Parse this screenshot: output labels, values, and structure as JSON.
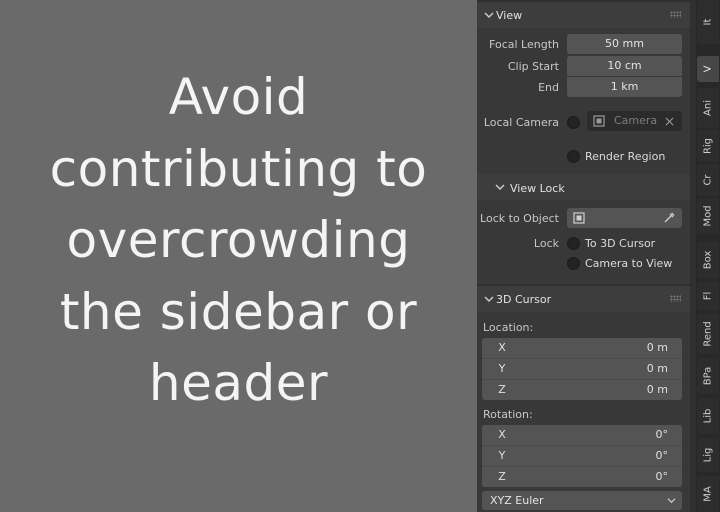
{
  "message": {
    "lines": [
      "Avoid",
      "contributing to",
      "overcrowding",
      "the sidebar or",
      "header"
    ]
  },
  "view_panel": {
    "title": "View",
    "focal_length_label": "Focal Length",
    "focal_length_value": "50 mm",
    "clip_start_label": "Clip Start",
    "clip_start_value": "10 cm",
    "clip_end_label": "End",
    "clip_end_value": "1 km",
    "local_camera_label": "Local Camera",
    "camera_placeholder": "Camera",
    "render_region_label": "Render Region",
    "view_lock": {
      "title": "View Lock",
      "lock_to_object_label": "Lock to Object",
      "lock_label": "Lock",
      "to_3d_cursor_label": "To 3D Cursor",
      "camera_to_view_label": "Camera to View"
    }
  },
  "cursor_panel": {
    "title": "3D Cursor",
    "location_label": "Location:",
    "location": [
      {
        "axis": "X",
        "value": "0 m"
      },
      {
        "axis": "Y",
        "value": "0 m"
      },
      {
        "axis": "Z",
        "value": "0 m"
      }
    ],
    "rotation_label": "Rotation:",
    "rotation": [
      {
        "axis": "X",
        "value": "0°"
      },
      {
        "axis": "Y",
        "value": "0°"
      },
      {
        "axis": "Z",
        "value": "0°"
      }
    ],
    "rotation_mode": "XYZ Euler"
  },
  "tabs": [
    {
      "label": "It"
    },
    {
      "label": "V"
    },
    {
      "label": "Ani"
    },
    {
      "label": "Rig"
    },
    {
      "label": "Cr"
    },
    {
      "label": "Mod"
    },
    {
      "label": "Box"
    },
    {
      "label": "Fl"
    },
    {
      "label": "Rend"
    },
    {
      "label": "BPa"
    },
    {
      "label": "Lib"
    },
    {
      "label": "Lig"
    },
    {
      "label": "MA"
    }
  ],
  "colors": {
    "background": "#6a6a6a",
    "panel": "#3d3d3d",
    "field": "#545454",
    "active_tab": "#474747"
  }
}
